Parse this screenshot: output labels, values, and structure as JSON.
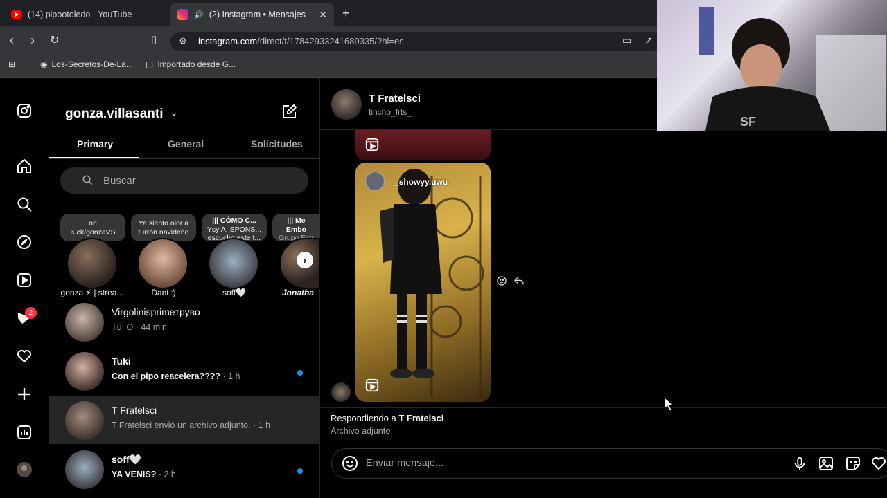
{
  "browser": {
    "tabs": [
      {
        "title": "(14) pipootoledo - YouTube",
        "favicon": "youtube-icon"
      },
      {
        "title": "(2) Instagram • Mensajes",
        "favicon": "instagram-icon",
        "active": true
      }
    ],
    "url_host": "instagram.com",
    "url_path": "/direct/t/17842933241689335/?hl=es",
    "bookmarks": [
      "Los-Secretos-De-La...",
      "Importado desde G..."
    ]
  },
  "rail": {
    "notification_count": "2"
  },
  "inbox": {
    "username": "gonza.villasanti",
    "tabs": [
      "Primary",
      "General",
      "Solicitudes"
    ],
    "search_placeholder": "Buscar",
    "notes": [
      {
        "line1": "on",
        "line2": "Kick/gonzaVS"
      },
      {
        "line1": "Ya siento olor a",
        "line2": "turrón navideño"
      },
      {
        "line1": "||| CÓMO C...",
        "line2": "Ysy A, SPONS...",
        "line3": "escucho este t..."
      },
      {
        "line1": "||| Me Embo",
        "line2": "Grupo Extr"
      }
    ],
    "stories": [
      "gonza ⚡ | strea...",
      "Dani :)",
      "soff🤍",
      "Jonatha"
    ],
    "threads": [
      {
        "name": "Virgolinisprimeтрувo",
        "preview": "Tú: O",
        "time": "· 44 min",
        "unread": false
      },
      {
        "name": "Tuki",
        "preview": "Con el pipo reacelera????",
        "time": "· 1 h",
        "unread": true
      },
      {
        "name": "T Fratelsci",
        "preview": "T Fratelsci envió un archivo adjunto.",
        "time": "· 1 h",
        "unread": false,
        "selected": true
      },
      {
        "name": "soff🤍",
        "preview": "YA VENIS?",
        "time": "· 2 h",
        "unread": true
      }
    ]
  },
  "chat": {
    "name": "T Fratelsci",
    "handle": "tincho_frts_",
    "reel_user": "_showyy.uwu",
    "reply_title_prefix": "Respondiendo a",
    "reply_title_name": "T Fratelsci",
    "reply_sub": "Archivo adjunto",
    "composer_placeholder": "Enviar mensaje..."
  },
  "colors": {
    "accent": "#0095f6",
    "badge": "#ff3040",
    "background": "#000000",
    "selected_row": "#262626"
  }
}
